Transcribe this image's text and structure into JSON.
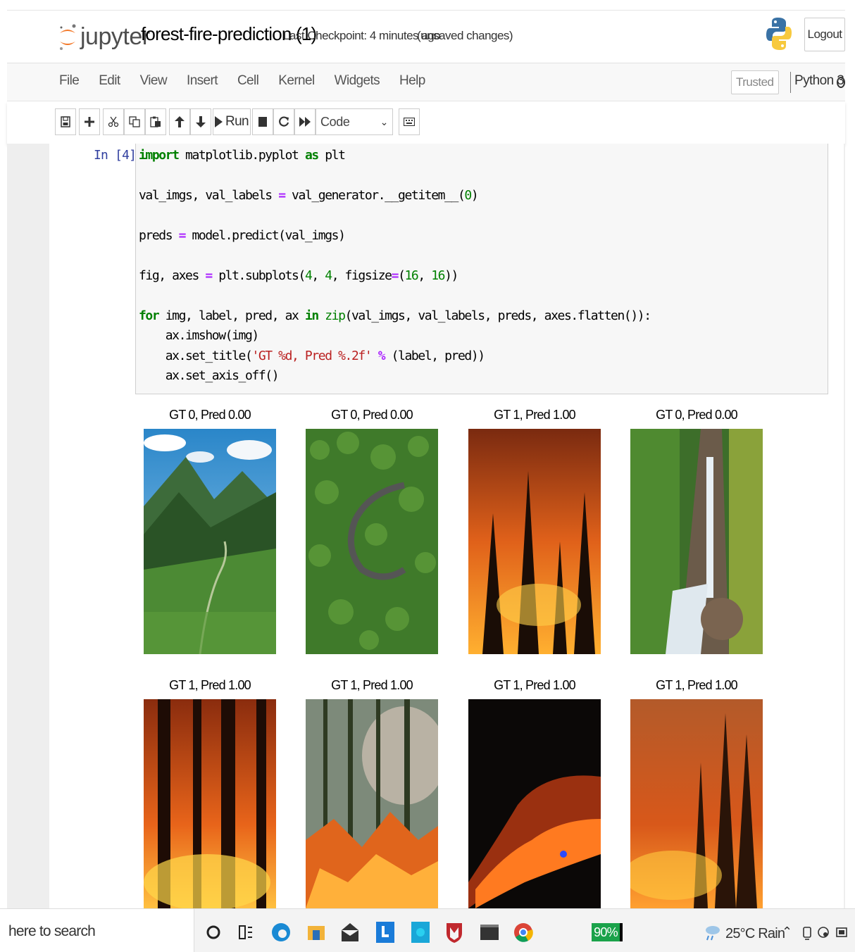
{
  "header": {
    "logo_text": "jupyter",
    "notebook_name": "forest-fire-prediction (1)",
    "checkpoint": "Last Checkpoint: 4 minutes ago",
    "autosave_status": "(unsaved changes)",
    "logout_label": "Logout"
  },
  "menubar": {
    "items": [
      "File",
      "Edit",
      "View",
      "Insert",
      "Cell",
      "Kernel",
      "Widgets",
      "Help"
    ],
    "trusted_label": "Trusted",
    "kernel_name": "Python 3"
  },
  "toolbar": {
    "run_label": "Run",
    "cell_type_selected": "Code",
    "buttons": [
      "save-icon",
      "plus-icon",
      "cut-icon",
      "copy-icon",
      "paste-icon",
      "arrow-up-icon",
      "arrow-down-icon",
      "run-icon",
      "stop-icon",
      "restart-icon",
      "fast-forward-icon",
      "keyboard-icon"
    ]
  },
  "cell": {
    "prompt": "In [4]:",
    "code": [
      "import matplotlib.pyplot as plt",
      "val_imgs, val_labels = val_generator.__getitem__(0)",
      "preds = model.predict(val_imgs)",
      "fig, axes = plt.subplots(4, 4, figsize=(16, 16))",
      "for img, label, pred, ax in zip(val_imgs, val_labels, preds, axes.flatten()):",
      "    ax.imshow(img)",
      "    ax.set_title('GT %d, Pred %.2f' % (label, pred))",
      "    ax.set_axis_off()"
    ]
  },
  "output": {
    "panels": [
      {
        "title": "GT 0, Pred 0.00",
        "scene": "mountain-valley"
      },
      {
        "title": "GT 0, Pred 0.00",
        "scene": "forest-road-aerial"
      },
      {
        "title": "GT 1, Pred 1.00",
        "scene": "forest-fire"
      },
      {
        "title": "GT 0, Pred 0.00",
        "scene": "waterfall-forest"
      },
      {
        "title": "GT 1, Pred 1.00",
        "scene": "forest-fire"
      },
      {
        "title": "GT 1, Pred 1.00",
        "scene": "forest-fire-smoke"
      },
      {
        "title": "GT 1, Pred 1.00",
        "scene": "night-fire"
      },
      {
        "title": "GT 1, Pred 1.00",
        "scene": "forest-fire"
      }
    ]
  },
  "taskbar": {
    "search_text": "here to search",
    "battery": "90%",
    "weather": "25°C Rain"
  },
  "colors": {
    "prompt": "#303f9f",
    "keyword": "#008000",
    "operator": "#aa22ff",
    "string": "#ba2121"
  }
}
